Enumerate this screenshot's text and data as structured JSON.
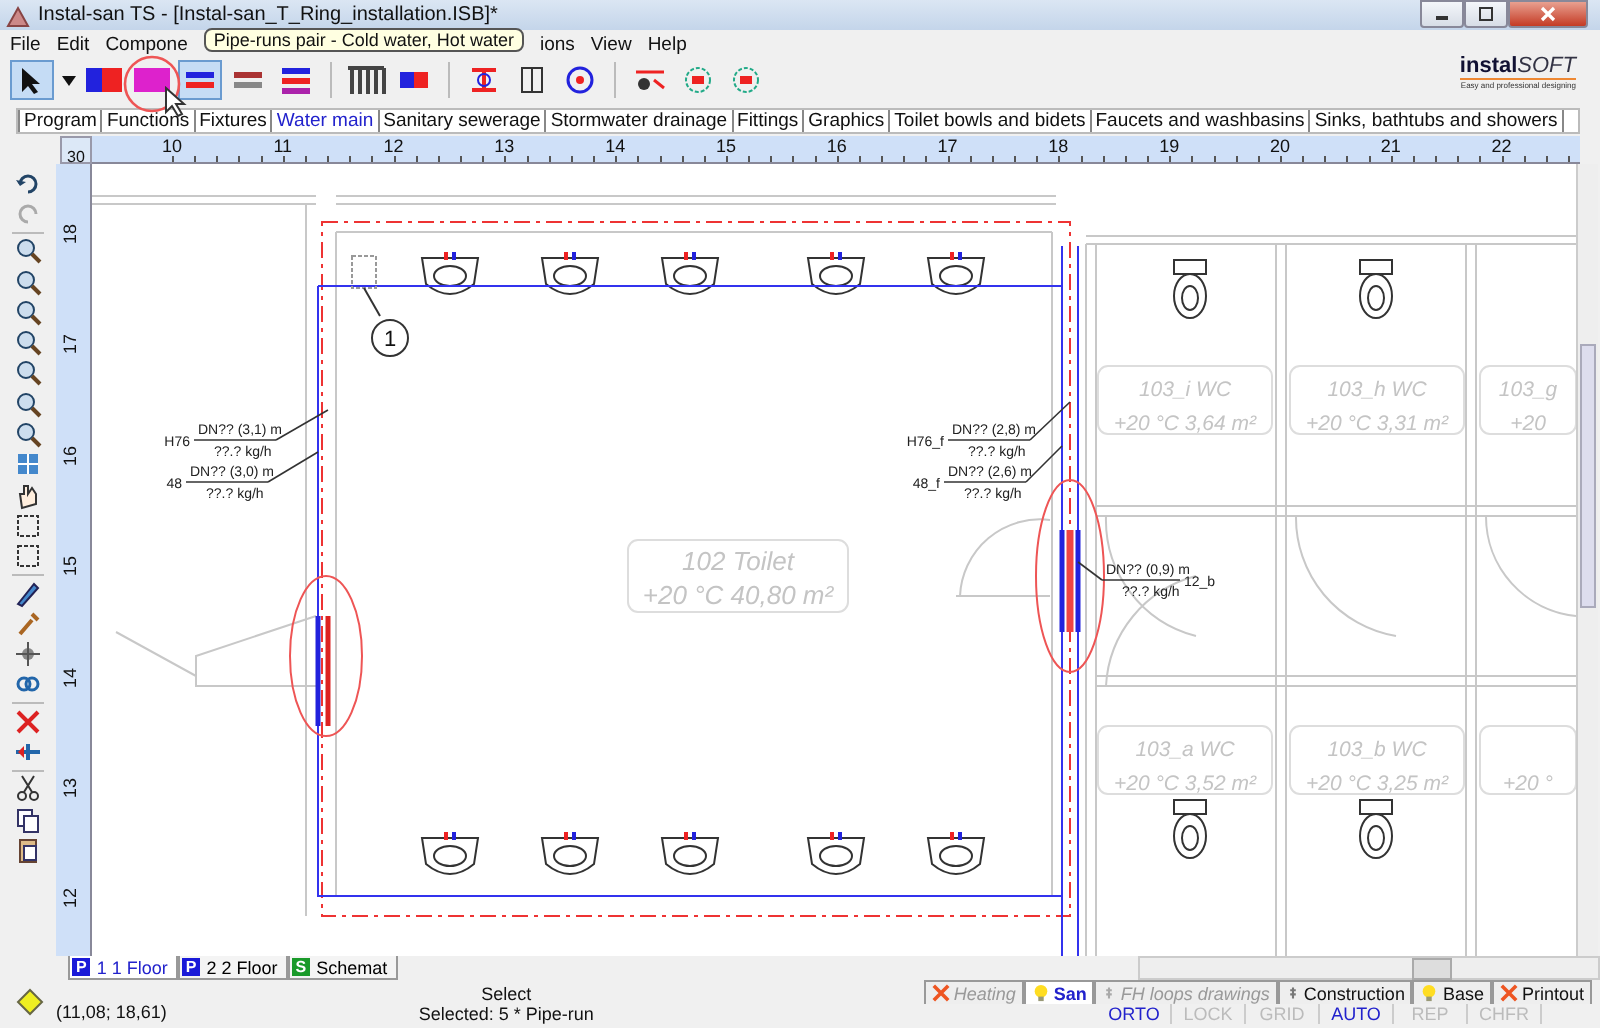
{
  "window": {
    "title": "Instal-san TS - [Instal-san_T_Ring_installation.ISB]*"
  },
  "menu": [
    "File",
    "Edit",
    "Compone",
    "ions",
    "View",
    "Help"
  ],
  "tooltip": "Pipe-runs pair - Cold water, Hot water",
  "toolbar": [
    {
      "selected": true
    },
    {
      "selected": false
    },
    {
      "selected": false
    },
    {
      "selected": false
    },
    {
      "selected": true
    },
    {
      "selected": false
    },
    {
      "selected": false
    },
    {
      "selected": false
    },
    {
      "selected": false
    },
    {
      "selected": false
    },
    {
      "selected": false
    },
    {
      "selected": false
    },
    {
      "selected": false
    },
    {
      "selected": false
    },
    {
      "selected": false
    }
  ],
  "logo": {
    "name": "instal",
    "suffix": "SOFT",
    "tagline": "Easy and professional designing"
  },
  "tabs": [
    {
      "label": "Program",
      "selected": false
    },
    {
      "label": "Functions",
      "selected": false
    },
    {
      "label": "Fixtures",
      "selected": false
    },
    {
      "label": "Water main",
      "selected": true
    },
    {
      "label": "Sanitary sewerage",
      "selected": false
    },
    {
      "label": "Stormwater drainage",
      "selected": false
    },
    {
      "label": "Fittings",
      "selected": false
    },
    {
      "label": "Graphics",
      "selected": false
    },
    {
      "label": "Toilet bowls and bidets",
      "selected": false
    },
    {
      "label": "Faucets and washbasins",
      "selected": false
    },
    {
      "label": "Sinks, bathtubs and showers",
      "selected": false
    }
  ],
  "ruler": {
    "corner": "30",
    "x_ticks": [
      "10",
      "11",
      "12",
      "13",
      "14",
      "15",
      "16",
      "17",
      "18",
      "19",
      "20",
      "21",
      "22"
    ],
    "y_ticks": [
      "18",
      "17",
      "16",
      "15",
      "14",
      "13",
      "12"
    ]
  },
  "drawing": {
    "rooms": [
      {
        "name": "102 Toilet",
        "info": "+20 °C 40,80 m²"
      },
      {
        "name": "103_i WC",
        "info": "+20 °C 3,64 m²"
      },
      {
        "name": "103_h WC",
        "info": "+20 °C 3,31 m²"
      },
      {
        "name": "103_g",
        "info": "+20"
      },
      {
        "name": "103_a WC",
        "info": "+20 °C 3,52 m²"
      },
      {
        "name": "103_b WC",
        "info": "+20 °C 3,25 m²"
      },
      {
        "info": "+20 °"
      }
    ],
    "pipe_labels": [
      {
        "tag": "H76",
        "dn": "DN?? (3,1) m",
        "flow": "??.? kg/h"
      },
      {
        "tag": "48",
        "dn": "DN?? (3,0) m",
        "flow": "??.? kg/h"
      },
      {
        "tag": "H76_f",
        "dn": "DN?? (2,8) m",
        "flow": "??.? kg/h"
      },
      {
        "tag": "48_f",
        "dn": "DN?? (2,6) m",
        "flow": "??.? kg/h"
      },
      {
        "tag": "12_b",
        "dn": "DN?? (0,9) m",
        "flow": "??.? kg/h"
      }
    ],
    "marker": "1"
  },
  "sheet_tabs": [
    {
      "badge": "P",
      "label": "1 1 Floor",
      "selected": true
    },
    {
      "badge": "P",
      "label": "2 2 Floor",
      "selected": false
    },
    {
      "badge": "S",
      "label": "Schemat",
      "selected": false
    }
  ],
  "layer_tabs": [
    {
      "label": "Heating",
      "kind": "cross",
      "disabled": true,
      "selected": false
    },
    {
      "label": "San",
      "kind": "bulb",
      "disabled": false,
      "selected": true
    },
    {
      "label": "FH loops drawings",
      "kind": "pin",
      "disabled": true,
      "selected": false
    },
    {
      "label": "Construction",
      "kind": "pin",
      "disabled": false,
      "selected": false
    },
    {
      "label": "Base",
      "kind": "bulb",
      "disabled": false,
      "selected": false
    },
    {
      "label": "Printout",
      "kind": "cross",
      "disabled": false,
      "selected": false
    }
  ],
  "status_bar": {
    "coordinates": "(11,08; 18,61)",
    "command": "Select",
    "selection": "Selected: 5 * Pipe-run",
    "modes": [
      {
        "label": "ORTO",
        "on": true
      },
      {
        "label": "LOCK",
        "on": false
      },
      {
        "label": "GRID",
        "on": false
      },
      {
        "label": "AUTO",
        "on": true
      },
      {
        "label": "REP",
        "on": false
      },
      {
        "label": "CHFR",
        "on": false
      }
    ]
  }
}
